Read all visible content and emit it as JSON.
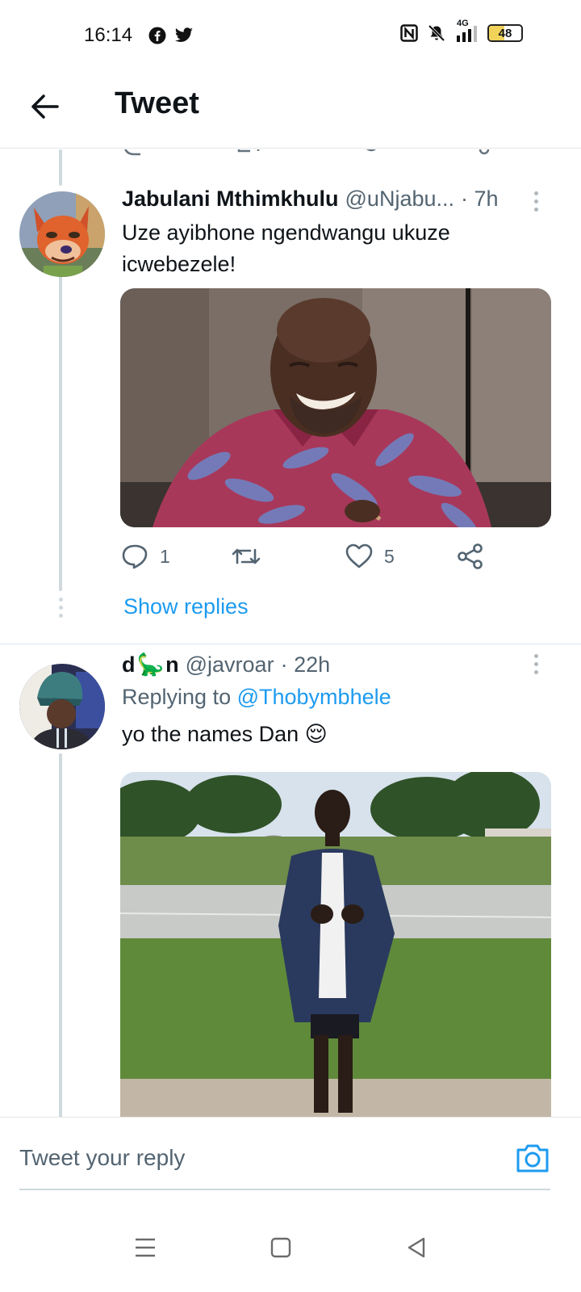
{
  "status_bar": {
    "time": "16:14",
    "network": "4G",
    "battery": "48",
    "battery_level_percent": 48,
    "icons": [
      "facebook-icon",
      "twitter-icon",
      "nfc-icon",
      "bell-muted-icon",
      "signal-icon"
    ]
  },
  "header": {
    "title": "Tweet",
    "back_icon": "arrow-left-icon"
  },
  "tweets": [
    {
      "name": "Jabulani Mthimkhulu",
      "handle": "@uNjabu...",
      "time": "· 7h",
      "text": "Uze ayibhone ngendwangu ukuze icwebezele!",
      "avatar": "fox-cartoon-avatar",
      "media": "photo-laughing-man-patterned-shirt",
      "reply_count": "1",
      "retweet_count": "",
      "like_count": "5",
      "show_replies": "Show replies"
    },
    {
      "name_prefix": "d",
      "name_emoji": "🦕",
      "name_suffix": "n",
      "handle": "@javroar",
      "time": "· 22h",
      "replying_label": "Replying to",
      "replying_handle": "@Thobymbhele",
      "text": "yo the names Dan 😌",
      "avatar": "person-blue-hat-avatar",
      "media": "photo-young-man-navy-blazer-grass"
    }
  ],
  "composer": {
    "placeholder": "Tweet your reply",
    "camera_icon": "camera-icon"
  },
  "nav_bar": {
    "icons": [
      "menu-icon",
      "home-square-icon",
      "back-triangle-icon"
    ]
  },
  "colors": {
    "accent": "#1d9bf0",
    "text": "#0f1419",
    "secondary": "#536471",
    "thread_line": "#cfd9de"
  }
}
